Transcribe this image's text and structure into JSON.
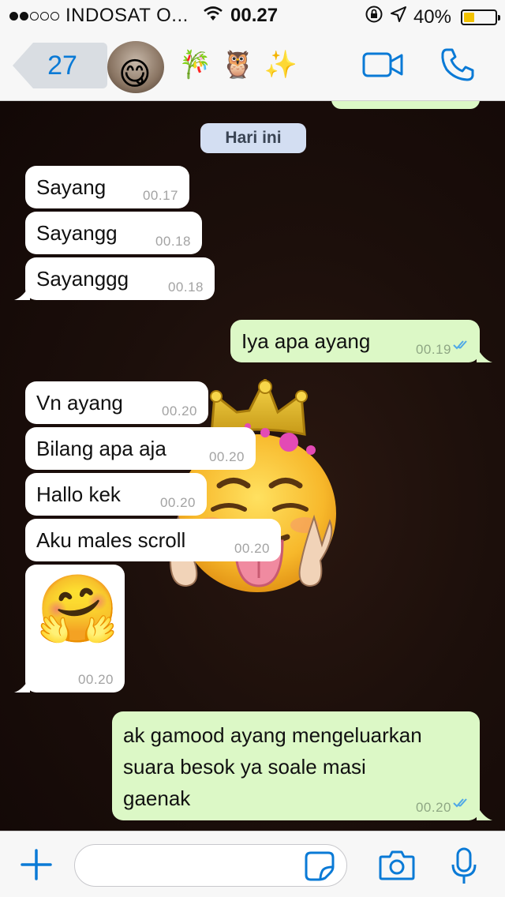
{
  "status_bar": {
    "carrier": "INDOSAT O...",
    "time": "00.27",
    "battery_percent": "40%",
    "battery_level": 0.4
  },
  "header": {
    "back_count": "27",
    "contact_emojis": [
      "🎋",
      "🦉",
      "✨"
    ],
    "avatar_emoji": "😋",
    "icons": [
      "video-call-icon",
      "phone-icon"
    ]
  },
  "chat": {
    "date_chip": "Hari ini",
    "messages": [
      {
        "dir": "in",
        "text": "Sayang",
        "time": "00.17"
      },
      {
        "dir": "in",
        "text": "Sayangg",
        "time": "00.18"
      },
      {
        "dir": "in",
        "text": "Sayanggg",
        "time": "00.18"
      },
      {
        "dir": "out",
        "text": "Iya apa ayang",
        "time": "00.19"
      },
      {
        "dir": "in",
        "text": "Vn ayang",
        "time": "00.20"
      },
      {
        "dir": "in",
        "text": "Bilang apa aja",
        "time": "00.20"
      },
      {
        "dir": "in",
        "text": "Hallo kek",
        "time": "00.20"
      },
      {
        "dir": "in",
        "text": "Aku males scroll",
        "time": "00.20"
      },
      {
        "dir": "in",
        "emoji": "🤗",
        "time": "00.20"
      },
      {
        "dir": "out",
        "lines": [
          "ak gamood ayang mengeluarkan",
          "suara besok ya soale masi",
          "gaenak"
        ],
        "time": "00.20"
      }
    ],
    "sticker_emoji": "👑"
  },
  "input_bar": {
    "icons": [
      "plus-icon",
      "sticker-icon",
      "camera-icon",
      "microphone-icon"
    ]
  },
  "colors": {
    "accent": "#0a7ad6",
    "incoming_bubble": "#ffffff",
    "outgoing_bubble": "#dcf8c6",
    "read_ticks": "#4fa8e6"
  }
}
